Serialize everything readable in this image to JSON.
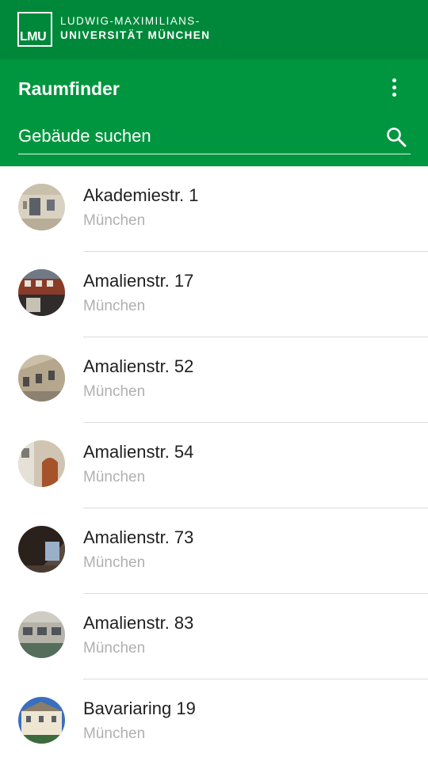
{
  "brand": {
    "logo_text": "LMU",
    "university_line1": "LUDWIG-MAXIMILIANS-",
    "university_line2": "UNIVERSITÄT MÜNCHEN",
    "primary_color": "#00883A",
    "appbar_color": "#00963F"
  },
  "appbar": {
    "title": "Raumfinder",
    "menu_icon": "more-vert-icon",
    "search_placeholder": "Gebäude suchen",
    "search_icon": "search-icon"
  },
  "buildings": [
    {
      "name": "Akademiestr. 1",
      "city": "München"
    },
    {
      "name": "Amalienstr. 17",
      "city": "München"
    },
    {
      "name": "Amalienstr. 52",
      "city": "München"
    },
    {
      "name": "Amalienstr. 54",
      "city": "München"
    },
    {
      "name": "Amalienstr. 73",
      "city": "München"
    },
    {
      "name": "Amalienstr. 83",
      "city": "München"
    },
    {
      "name": "Bavariaring 19",
      "city": "München"
    }
  ]
}
